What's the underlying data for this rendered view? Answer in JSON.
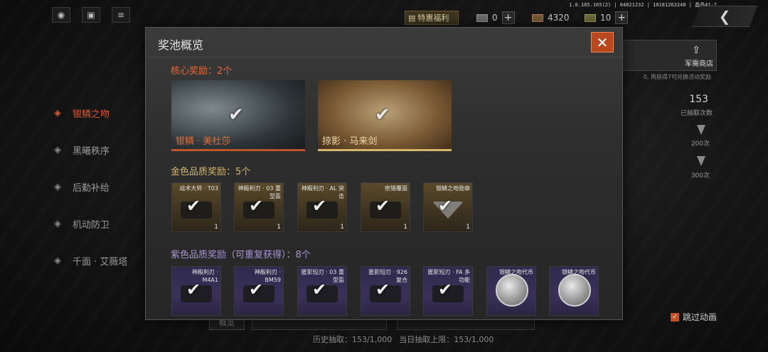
{
  "colors": {
    "accent_orange": "#e76a32",
    "gold": "#d6b76a",
    "purple": "#a893d6",
    "close_bg": "#b9481f"
  },
  "topbar": {
    "version": "1.0.165.165(2) | 04021232 | 10181263248 | 晶晶41-7",
    "promo_label": "特惠福利",
    "currency1_value": "0",
    "currency2_value": "4320",
    "currency3_value": "10",
    "plus_label": "+",
    "back_arrow": "❮"
  },
  "left_menu": {
    "items": [
      {
        "label": "银鳞之吻",
        "icon": "diamond-icon",
        "active": true
      },
      {
        "label": "黑曦秩序",
        "icon": "diamond-icon",
        "active": false
      },
      {
        "label": "后勤补给",
        "icon": "diamond-icon",
        "active": false
      },
      {
        "label": "机动防卫",
        "icon": "diamond-icon",
        "active": false
      },
      {
        "label": "千面 · 艾薇塔",
        "icon": "diamond-icon",
        "active": false
      }
    ]
  },
  "right_panel": {
    "shop_label": "军需商店",
    "note": "0, 再获得7可兑换活动奖励",
    "count": "153",
    "count_label": "已抽取次数",
    "milestone1": "200次",
    "milestone2": "300次",
    "skip_label": "跳过动画"
  },
  "bottom": {
    "tab_label": "概览",
    "history": "历史抽取：153/1,000",
    "daily": "当日抽取上限：153/1,000"
  },
  "modal": {
    "title": "奖池概览",
    "close_label": "✕",
    "core_section": "核心奖励：2个",
    "core_items": [
      {
        "label": "银鳞 · 美杜莎"
      },
      {
        "label": "掠影 · 马来剑"
      }
    ],
    "gold_section": "金色品质奖励：5个",
    "gold_items": [
      {
        "name": "战术大师 · T03",
        "count": "1"
      },
      {
        "name": "神殿利刃 · 03 重型盔",
        "count": "1"
      },
      {
        "name": "神殿利刃 · AL 突击",
        "count": "1"
      },
      {
        "name": "密猎覆面",
        "count": "1"
      },
      {
        "name": "银鳞之吻勋章",
        "count": "1"
      }
    ],
    "purple_section": "紫色品质奖励（可重复获得）：8个",
    "purple_items": [
      {
        "name": "神殿利刃 · M4A1"
      },
      {
        "name": "神殿利刃 · BM59"
      },
      {
        "name": "匿影短刃 · 03 重型盔"
      },
      {
        "name": "匿影短刃 · 926 复合"
      },
      {
        "name": "匿影短刃 · FA 多功能"
      },
      {
        "name": "银鳞之吻代币"
      },
      {
        "name": "银鳞之吻代币"
      }
    ]
  }
}
